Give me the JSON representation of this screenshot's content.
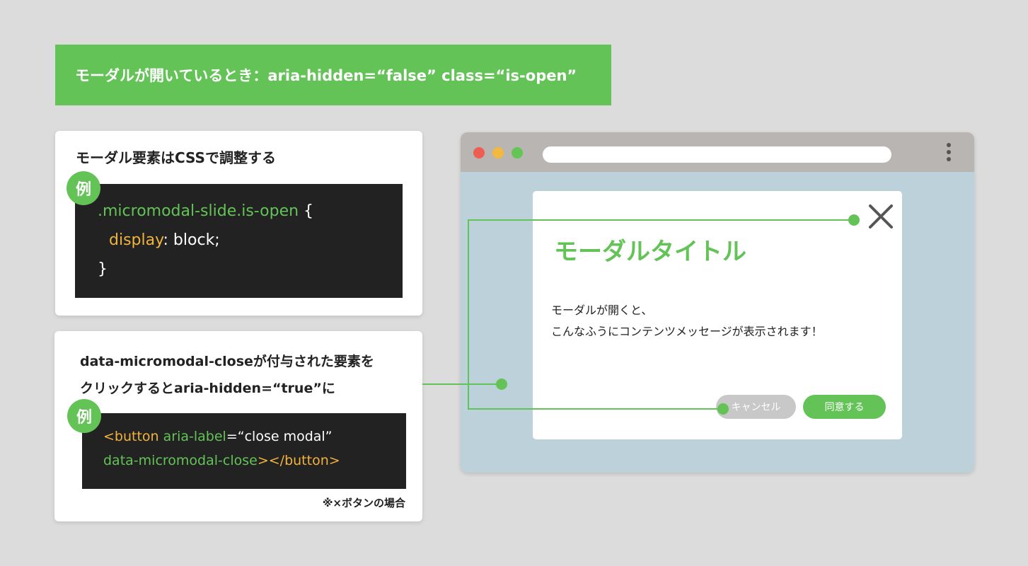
{
  "banner": {
    "text": "モーダルが開いているとき：aria-hidden=“false” class=“is-open”"
  },
  "card_css": {
    "title": "モーダル要素はCSSで調整する",
    "badge": "例",
    "code": {
      "selector": ".micromodal-slide.is-open",
      "open_brace": " {",
      "property": "display",
      "value": ": block;",
      "close_brace": "}"
    }
  },
  "card_close": {
    "title_line1": "data-micromodal-closeが付与された要素を",
    "title_line2": "クリックするとaria-hidden=“true”に",
    "badge": "例",
    "code": {
      "tag_open": "<button",
      "attr": " aria-label",
      "attr_value": "=“close modal”",
      "attr2": "data-micromodal-close",
      "tag_close": "></button>"
    },
    "note": "※×ボタンの場合"
  },
  "browser": {
    "modal": {
      "title": "モーダルタイトル",
      "body_line1": "モーダルが開くと、",
      "body_line2": "こんなふうにコンテンツメッセージが表示されます！",
      "cancel_label": "キャンセル",
      "agree_label": "同意する"
    }
  },
  "colors": {
    "accent": "#63c356",
    "code_bg": "#222222",
    "code_yellow": "#f2b33d",
    "browser_bg": "#bdd1da",
    "page_bg": "#dcdcdc"
  }
}
